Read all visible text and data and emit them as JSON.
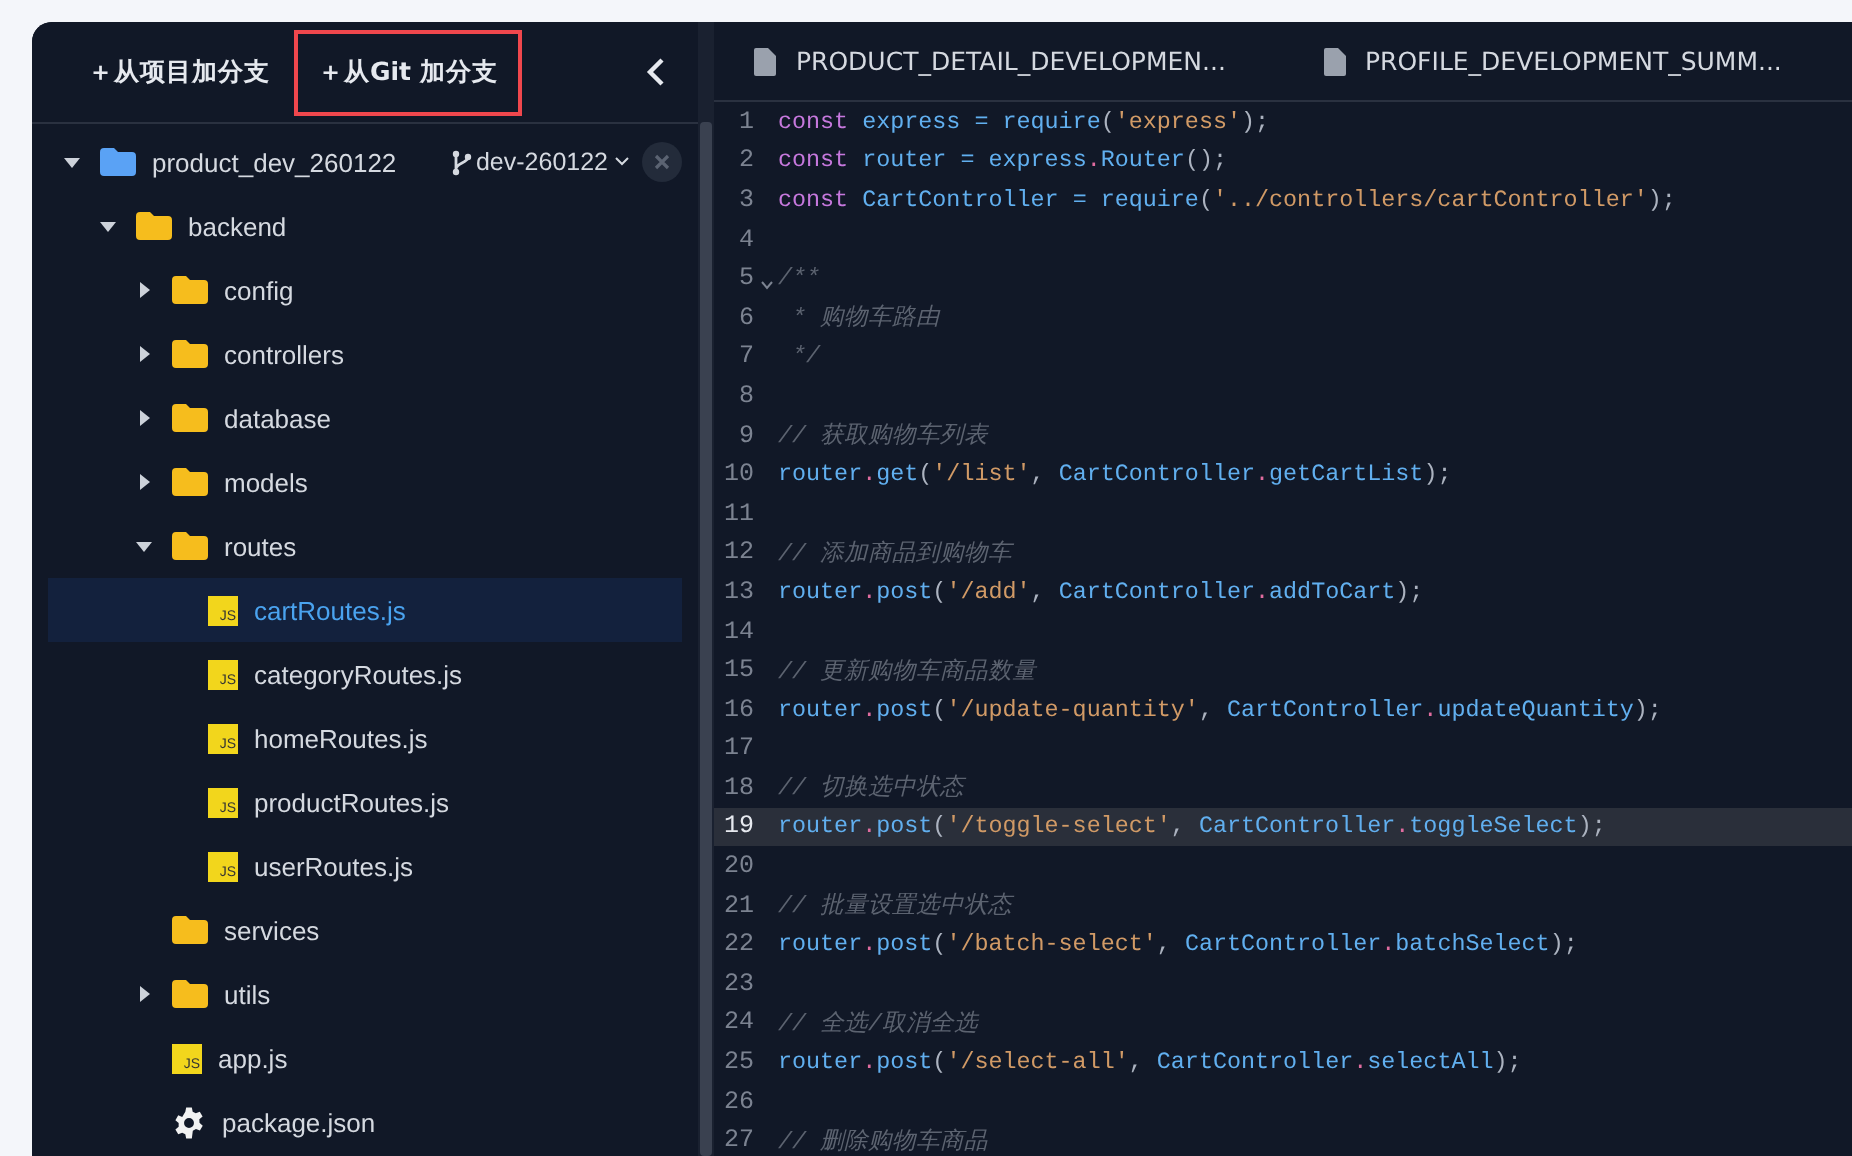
{
  "sidebar": {
    "buttons": [
      {
        "label": "＋从项目加分支",
        "highlighted": false
      },
      {
        "label": "＋从Git 加分支",
        "highlighted": true
      }
    ],
    "tree": [
      {
        "name": "product_dev_260122",
        "kind": "project",
        "expanded": true,
        "selected": false,
        "branch": "dev-260122",
        "children": [
          {
            "name": "backend",
            "kind": "folder",
            "expanded": true,
            "selected": false,
            "children": [
              {
                "name": "config",
                "kind": "folder",
                "expanded": false,
                "selected": false
              },
              {
                "name": "controllers",
                "kind": "folder",
                "expanded": false,
                "selected": false
              },
              {
                "name": "database",
                "kind": "folder",
                "expanded": false,
                "selected": false
              },
              {
                "name": "models",
                "kind": "folder",
                "expanded": false,
                "selected": false
              },
              {
                "name": "routes",
                "kind": "folder",
                "expanded": true,
                "selected": false,
                "children": [
                  {
                    "name": "cartRoutes.js",
                    "kind": "js",
                    "badge": "JS",
                    "selected": true
                  },
                  {
                    "name": "categoryRoutes.js",
                    "kind": "js",
                    "badge": "JS",
                    "selected": false
                  },
                  {
                    "name": "homeRoutes.js",
                    "kind": "js",
                    "badge": "JS",
                    "selected": false
                  },
                  {
                    "name": "productRoutes.js",
                    "kind": "js",
                    "badge": "JS",
                    "selected": false
                  },
                  {
                    "name": "userRoutes.js",
                    "kind": "js",
                    "badge": "JS",
                    "selected": false
                  }
                ]
              },
              {
                "name": "services",
                "kind": "folder",
                "selected": false
              },
              {
                "name": "utils",
                "kind": "folder",
                "expanded": false,
                "selected": false
              },
              {
                "name": "app.js",
                "kind": "js",
                "badge": "JS",
                "selected": false
              },
              {
                "name": "package.json",
                "kind": "config",
                "selected": false
              }
            ]
          }
        ]
      }
    ]
  },
  "editor": {
    "tabs": [
      {
        "label": "PRODUCT_DETAIL_DEVELOPMEN...",
        "selected": false
      },
      {
        "label": "PROFILE_DEVELOPMENT_SUMM...",
        "selected": false
      }
    ],
    "lines": [
      {
        "number": "1",
        "current": false,
        "tokens": [
          {
            "kind": "kw",
            "text": "const "
          },
          {
            "kind": "id",
            "text": "express "
          },
          {
            "kind": "op",
            "text": "= "
          },
          {
            "kind": "fn",
            "text": "require"
          },
          {
            "kind": "p",
            "text": "("
          },
          {
            "kind": "str",
            "text": "'express'"
          },
          {
            "kind": "p",
            "text": ");"
          }
        ]
      },
      {
        "number": "2",
        "current": false,
        "tokens": [
          {
            "kind": "kw",
            "text": "const "
          },
          {
            "kind": "id",
            "text": "router "
          },
          {
            "kind": "op",
            "text": "= "
          },
          {
            "kind": "id",
            "text": "express"
          },
          {
            "kind": "dot",
            "text": "."
          },
          {
            "kind": "fn",
            "text": "Router"
          },
          {
            "kind": "p",
            "text": "();"
          }
        ]
      },
      {
        "number": "3",
        "current": false,
        "tokens": [
          {
            "kind": "kw",
            "text": "const "
          },
          {
            "kind": "id",
            "text": "CartController "
          },
          {
            "kind": "op",
            "text": "= "
          },
          {
            "kind": "fn",
            "text": "require"
          },
          {
            "kind": "p",
            "text": "("
          },
          {
            "kind": "str",
            "text": "'../controllers/cartController'"
          },
          {
            "kind": "p",
            "text": ");"
          }
        ]
      },
      {
        "number": "4",
        "current": false
      },
      {
        "number": "5",
        "current": false,
        "fold": true,
        "tokens": [
          {
            "kind": "cmt",
            "text": "/**"
          }
        ]
      },
      {
        "number": "6",
        "current": false,
        "tokens": [
          {
            "kind": "cmt",
            "text": " * 购物车路由"
          }
        ]
      },
      {
        "number": "7",
        "current": false,
        "tokens": [
          {
            "kind": "cmt",
            "text": " */"
          }
        ]
      },
      {
        "number": "8",
        "current": false
      },
      {
        "number": "9",
        "current": false,
        "tokens": [
          {
            "kind": "cmt",
            "text": "// 获取购物车列表"
          }
        ]
      },
      {
        "number": "10",
        "current": false,
        "tokens": [
          {
            "kind": "id",
            "text": "router"
          },
          {
            "kind": "dot",
            "text": "."
          },
          {
            "kind": "fn",
            "text": "get"
          },
          {
            "kind": "p",
            "text": "("
          },
          {
            "kind": "str",
            "text": "'/list'"
          },
          {
            "kind": "p",
            "text": ", "
          },
          {
            "kind": "id",
            "text": "CartController"
          },
          {
            "kind": "dot",
            "text": "."
          },
          {
            "kind": "fn",
            "text": "getCartList"
          },
          {
            "kind": "p",
            "text": ");"
          }
        ]
      },
      {
        "number": "11",
        "current": false
      },
      {
        "number": "12",
        "current": false,
        "tokens": [
          {
            "kind": "cmt",
            "text": "// 添加商品到购物车"
          }
        ]
      },
      {
        "number": "13",
        "current": false,
        "tokens": [
          {
            "kind": "id",
            "text": "router"
          },
          {
            "kind": "dot",
            "text": "."
          },
          {
            "kind": "fn",
            "text": "post"
          },
          {
            "kind": "p",
            "text": "("
          },
          {
            "kind": "str",
            "text": "'/add'"
          },
          {
            "kind": "p",
            "text": ", "
          },
          {
            "kind": "id",
            "text": "CartController"
          },
          {
            "kind": "dot",
            "text": "."
          },
          {
            "kind": "fn",
            "text": "addToCart"
          },
          {
            "kind": "p",
            "text": ");"
          }
        ]
      },
      {
        "number": "14",
        "current": false
      },
      {
        "number": "15",
        "current": false,
        "tokens": [
          {
            "kind": "cmt",
            "text": "// 更新购物车商品数量"
          }
        ]
      },
      {
        "number": "16",
        "current": false,
        "tokens": [
          {
            "kind": "id",
            "text": "router"
          },
          {
            "kind": "dot",
            "text": "."
          },
          {
            "kind": "fn",
            "text": "post"
          },
          {
            "kind": "p",
            "text": "("
          },
          {
            "kind": "str",
            "text": "'/update-quantity'"
          },
          {
            "kind": "p",
            "text": ", "
          },
          {
            "kind": "id",
            "text": "CartController"
          },
          {
            "kind": "dot",
            "text": "."
          },
          {
            "kind": "fn",
            "text": "updateQuantity"
          },
          {
            "kind": "p",
            "text": ");"
          }
        ]
      },
      {
        "number": "17",
        "current": false
      },
      {
        "number": "18",
        "current": false,
        "tokens": [
          {
            "kind": "cmt",
            "text": "// 切换选中状态"
          }
        ]
      },
      {
        "number": "19",
        "current": true,
        "tokens": [
          {
            "kind": "id",
            "text": "router"
          },
          {
            "kind": "dot",
            "text": "."
          },
          {
            "kind": "fn",
            "text": "post"
          },
          {
            "kind": "p",
            "text": "("
          },
          {
            "kind": "str",
            "text": "'/toggle-select'"
          },
          {
            "kind": "p",
            "text": ", "
          },
          {
            "kind": "id",
            "text": "CartController"
          },
          {
            "kind": "dot",
            "text": "."
          },
          {
            "kind": "fn",
            "text": "toggleSelect"
          },
          {
            "kind": "p",
            "text": ");"
          }
        ]
      },
      {
        "number": "20",
        "current": false
      },
      {
        "number": "21",
        "current": false,
        "tokens": [
          {
            "kind": "cmt",
            "text": "// 批量设置选中状态"
          }
        ]
      },
      {
        "number": "22",
        "current": false,
        "tokens": [
          {
            "kind": "id",
            "text": "router"
          },
          {
            "kind": "dot",
            "text": "."
          },
          {
            "kind": "fn",
            "text": "post"
          },
          {
            "kind": "p",
            "text": "("
          },
          {
            "kind": "str",
            "text": "'/batch-select'"
          },
          {
            "kind": "p",
            "text": ", "
          },
          {
            "kind": "id",
            "text": "CartController"
          },
          {
            "kind": "dot",
            "text": "."
          },
          {
            "kind": "fn",
            "text": "batchSelect"
          },
          {
            "kind": "p",
            "text": ");"
          }
        ]
      },
      {
        "number": "23",
        "current": false
      },
      {
        "number": "24",
        "current": false,
        "tokens": [
          {
            "kind": "cmt",
            "text": "// 全选/取消全选"
          }
        ]
      },
      {
        "number": "25",
        "current": false,
        "tokens": [
          {
            "kind": "id",
            "text": "router"
          },
          {
            "kind": "dot",
            "text": "."
          },
          {
            "kind": "fn",
            "text": "post"
          },
          {
            "kind": "p",
            "text": "("
          },
          {
            "kind": "str",
            "text": "'/select-all'"
          },
          {
            "kind": "p",
            "text": ", "
          },
          {
            "kind": "id",
            "text": "CartController"
          },
          {
            "kind": "dot",
            "text": "."
          },
          {
            "kind": "fn",
            "text": "selectAll"
          },
          {
            "kind": "p",
            "text": ");"
          }
        ]
      },
      {
        "number": "26",
        "current": false
      },
      {
        "number": "27",
        "current": false,
        "tokens": [
          {
            "kind": "cmt",
            "text": "// 删除购物车商品"
          }
        ]
      }
    ]
  }
}
